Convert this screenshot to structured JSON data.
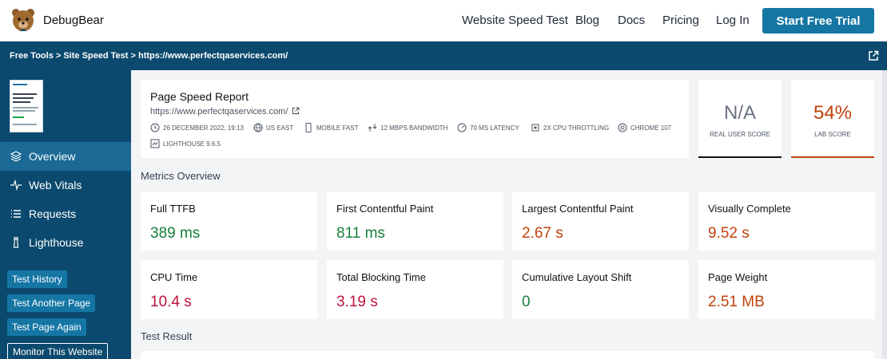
{
  "header": {
    "brand": "DebugBear",
    "nav": [
      "Website Speed Test",
      "Blog",
      "Docs",
      "Pricing",
      "Log In"
    ],
    "cta": "Start Free Trial"
  },
  "breadcrumb": "Free Tools > Site Speed Test > https://www.perfectqaservices.com/",
  "sidebar": {
    "items": [
      {
        "label": "Overview",
        "icon": "layers-icon"
      },
      {
        "label": "Web Vitals",
        "icon": "pulse-icon"
      },
      {
        "label": "Requests",
        "icon": "list-icon"
      },
      {
        "label": "Lighthouse",
        "icon": "lighthouse-icon"
      }
    ],
    "buttons": [
      "Test History",
      "Test Another Page",
      "Test Page Again",
      "Monitor This Website"
    ]
  },
  "report": {
    "title": "Page Speed Report",
    "url": "https://www.perfectqaservices.com/",
    "meta": [
      "26 December 2022, 19:13",
      "US East",
      "Mobile Fast",
      "12 Mbps Bandwidth",
      "70 ms Latency",
      "2x CPU Throttling",
      "Chrome 107",
      "Lighthouse 9.6.5"
    ]
  },
  "scores": {
    "real_user": {
      "value": "N/A",
      "label": "REAL USER SCORE"
    },
    "lab": {
      "value": "54%",
      "label": "LAB SCORE"
    }
  },
  "sections": {
    "metrics_overview": "Metrics Overview",
    "test_result": "Test Result"
  },
  "metrics": [
    {
      "label": "Full TTFB",
      "value": "389 ms",
      "status": "good"
    },
    {
      "label": "First Contentful Paint",
      "value": "811 ms",
      "status": "good"
    },
    {
      "label": "Largest Contentful Paint",
      "value": "2.67 s",
      "status": "ok"
    },
    {
      "label": "Visually Complete",
      "value": "9.52 s",
      "status": "ok"
    },
    {
      "label": "CPU Time",
      "value": "10.4 s",
      "status": "bad"
    },
    {
      "label": "Total Blocking Time",
      "value": "3.19 s",
      "status": "bad"
    },
    {
      "label": "Cumulative Layout Shift",
      "value": "0",
      "status": "good"
    },
    {
      "label": "Page Weight",
      "value": "2.51 MB",
      "status": "ok"
    }
  ],
  "colors": {
    "primary": "#1576a4",
    "navy": "#0b4a6e",
    "good": "#16803c",
    "needs_improvement": "#c2410c",
    "poor": "#be123c"
  }
}
